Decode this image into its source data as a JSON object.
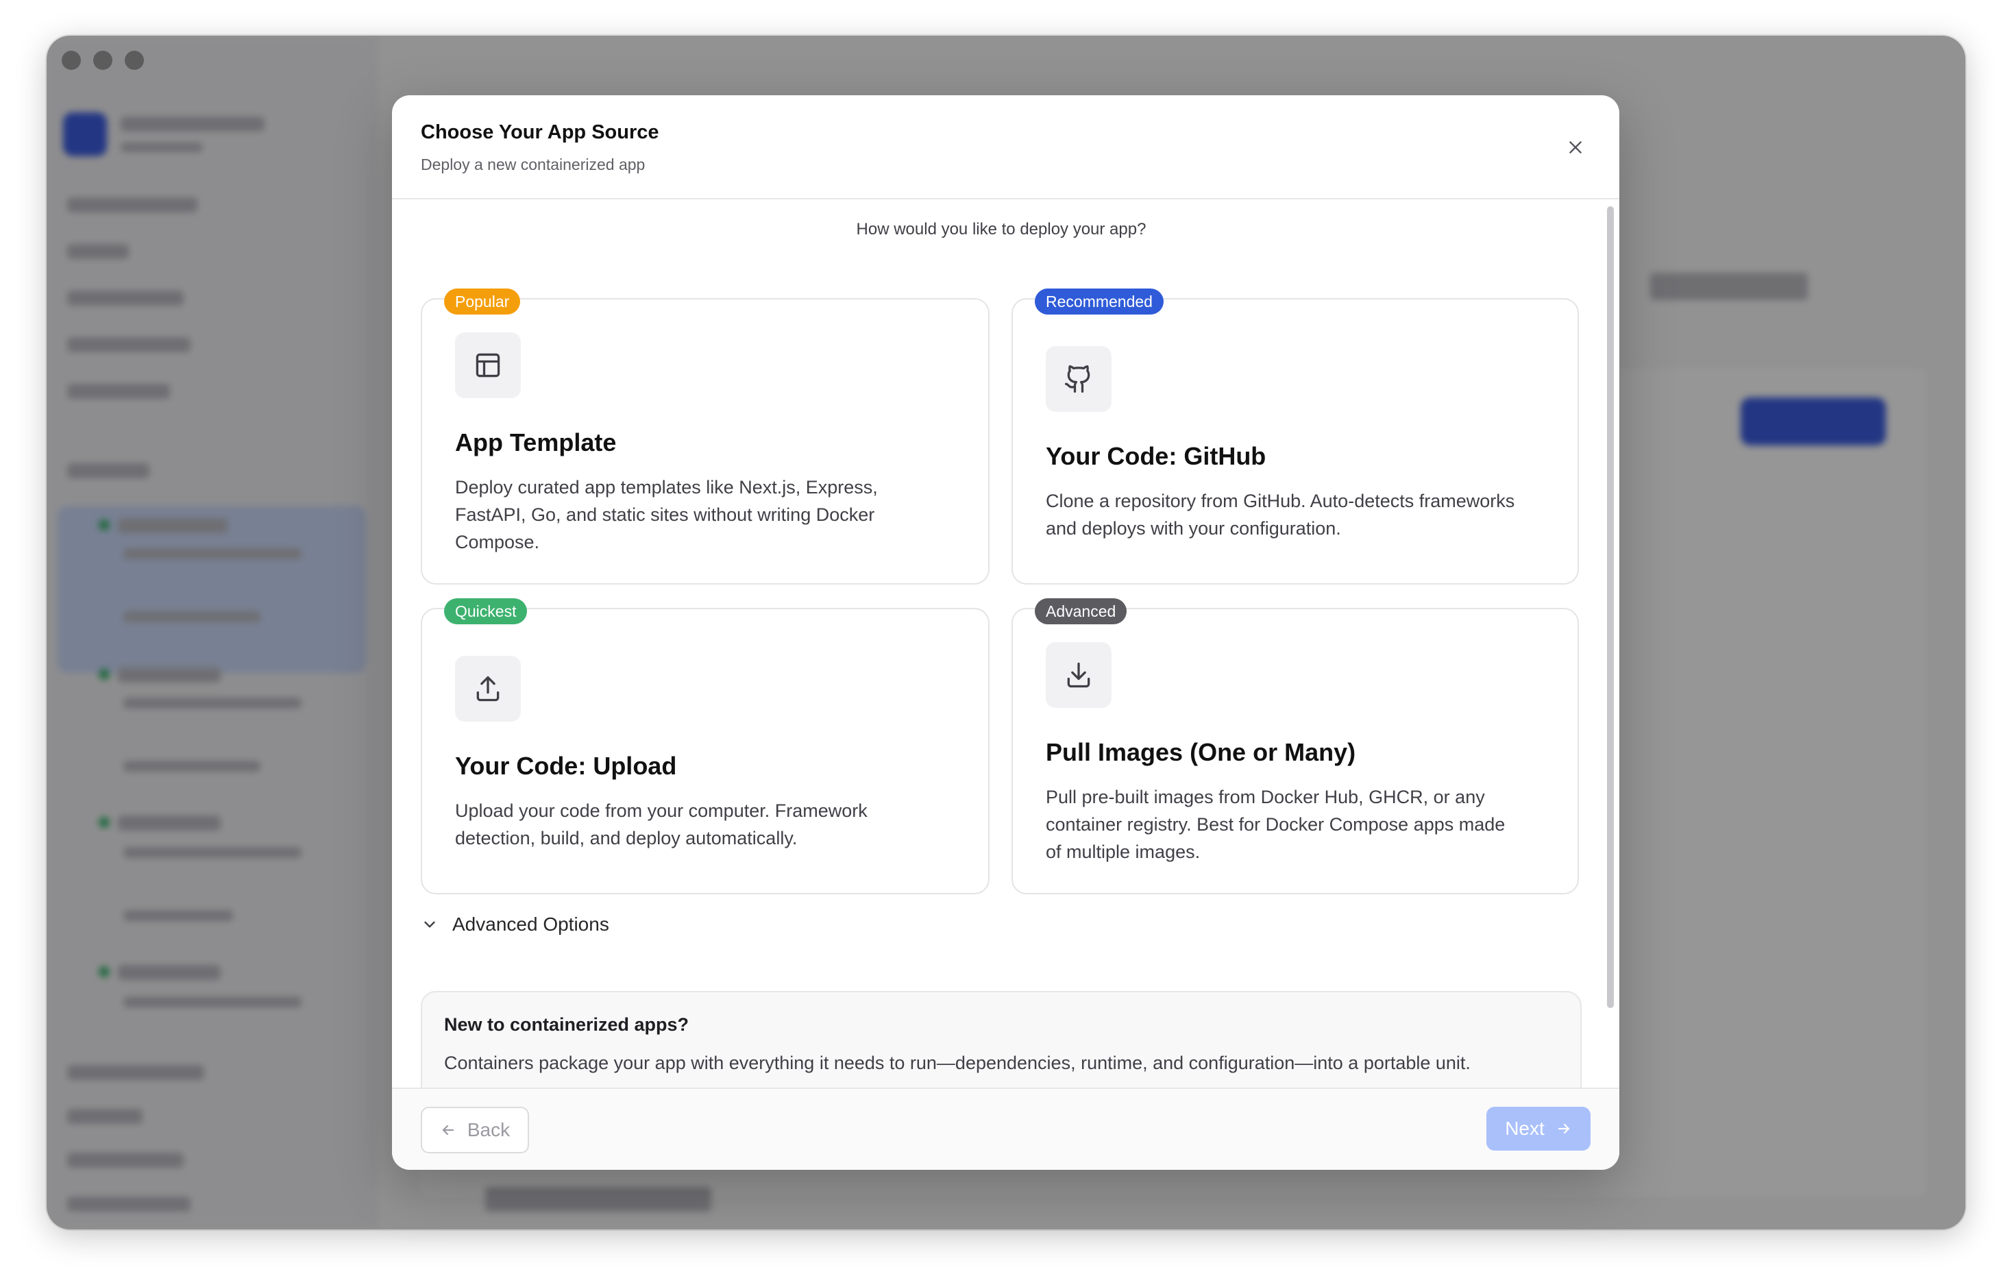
{
  "modal": {
    "title": "Choose Your App Source",
    "subtitle": "Deploy a new containerized app",
    "question": "How would you like to deploy your app?",
    "cards": [
      {
        "badge": "Popular",
        "badge_color": "#F59E0B",
        "icon": "layout-template-icon",
        "title": "App Template",
        "description": "Deploy curated app templates like Next.js, Express, FastAPI, Go, and static sites without writing Docker Compose."
      },
      {
        "badge": "Recommended",
        "badge_color": "#2F5BD8",
        "icon": "github-icon",
        "title": "Your Code: GitHub",
        "description": "Clone a repository from GitHub. Auto-detects frameworks and deploys with your configuration."
      },
      {
        "badge": "Quickest",
        "badge_color": "#3DB26F",
        "icon": "upload-icon",
        "title": "Your Code: Upload",
        "description": "Upload your code from your computer. Framework detection, build, and deploy automatically."
      },
      {
        "badge": "Advanced",
        "badge_color": "#5B5B60",
        "icon": "download-icon",
        "title": "Pull Images (One or Many)",
        "description": "Pull pre-built images from Docker Hub, GHCR, or any container registry. Best for Docker Compose apps made of multiple images."
      }
    ],
    "advanced_options_label": "Advanced Options",
    "info": {
      "title": "New to containerized apps?",
      "text": "Containers package your app with everything it needs to run—dependencies, runtime, and configuration—into a portable unit."
    },
    "footer": {
      "back_label": "Back",
      "next_label": "Next"
    }
  }
}
